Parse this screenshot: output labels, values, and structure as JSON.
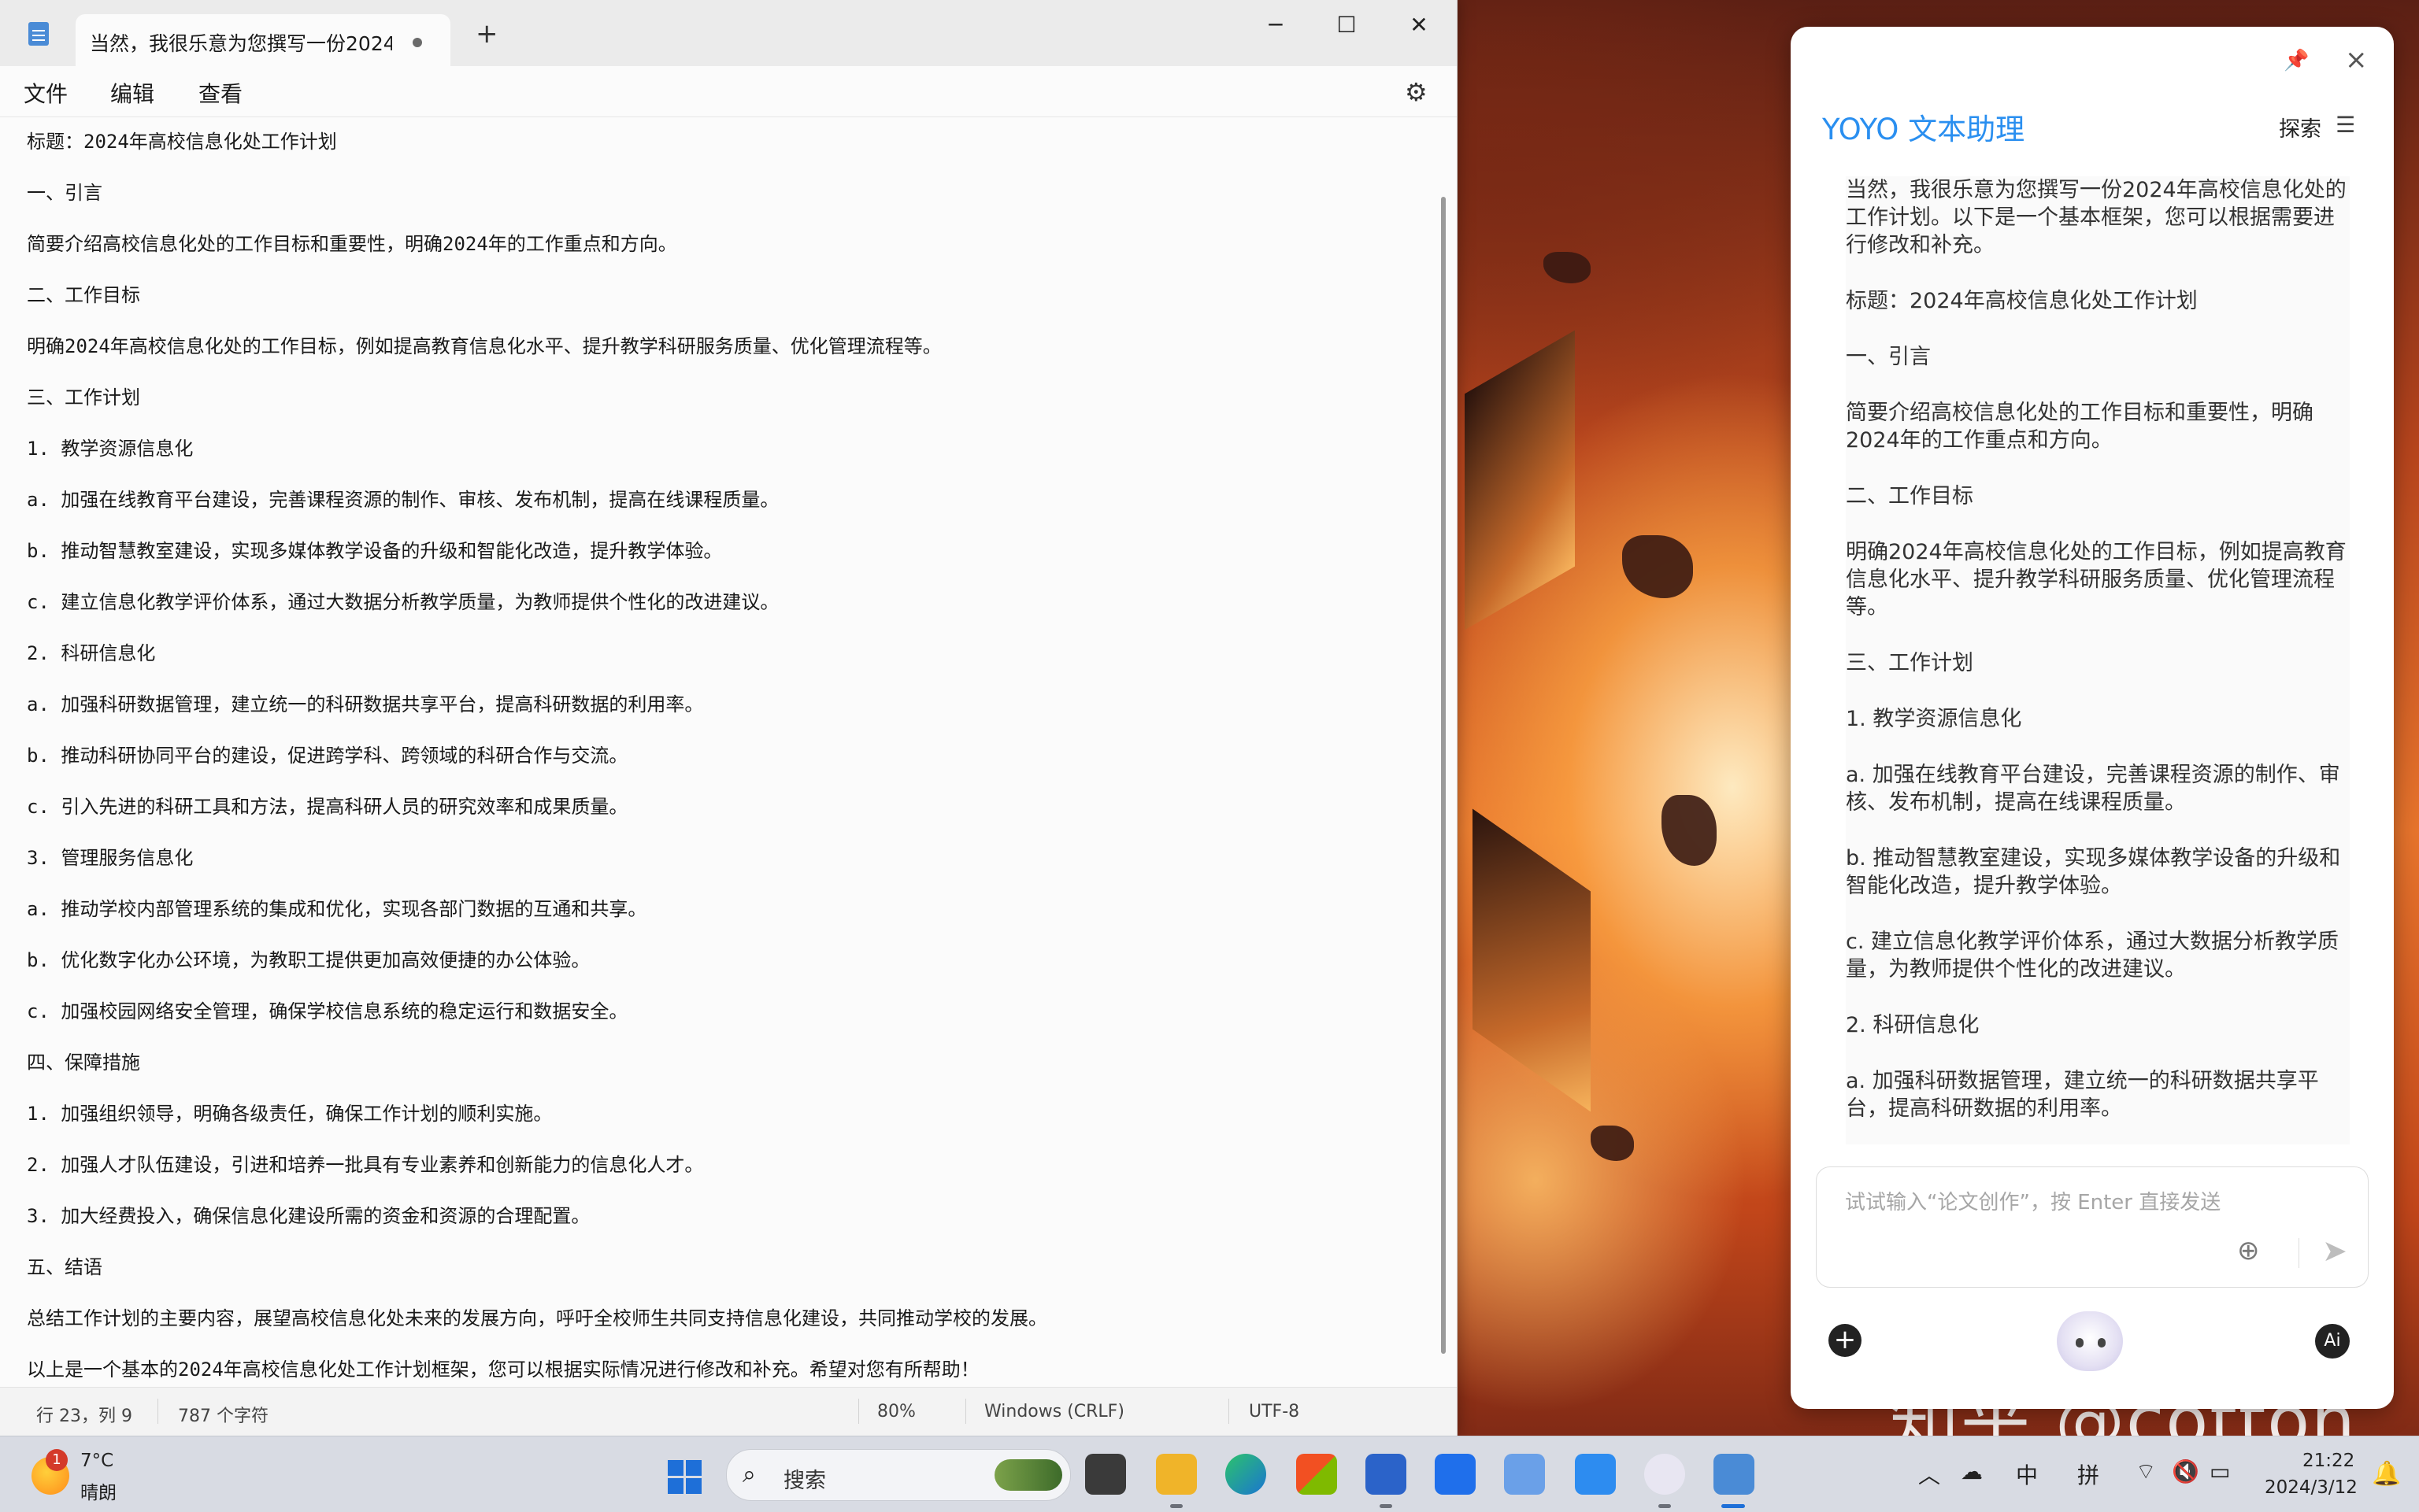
{
  "notepad": {
    "tab_title": "当然，我很乐意为您撰写一份2024年",
    "menu": [
      "文件",
      "编辑",
      "查看"
    ],
    "lines": [
      "标题：2024年高校信息化处工作计划",
      "一、引言",
      "简要介绍高校信息化处的工作目标和重要性，明确2024年的工作重点和方向。",
      "二、工作目标",
      "明确2024年高校信息化处的工作目标，例如提高教育信息化水平、提升教学科研服务质量、优化管理流程等。",
      "三、工作计划",
      "1. 教学资源信息化",
      "a. 加强在线教育平台建设，完善课程资源的制作、审核、发布机制，提高在线课程质量。",
      "b. 推动智慧教室建设，实现多媒体教学设备的升级和智能化改造，提升教学体验。",
      "c. 建立信息化教学评价体系，通过大数据分析教学质量，为教师提供个性化的改进建议。",
      "2. 科研信息化",
      "a. 加强科研数据管理，建立统一的科研数据共享平台，提高科研数据的利用率。",
      "b. 推动科研协同平台的建设，促进跨学科、跨领域的科研合作与交流。",
      "c. 引入先进的科研工具和方法，提高科研人员的研究效率和成果质量。",
      "3. 管理服务信息化",
      "a. 推动学校内部管理系统的集成和优化，实现各部门数据的互通和共享。",
      "b. 优化数字化办公环境，为教职工提供更加高效便捷的办公体验。",
      "c. 加强校园网络安全管理，确保学校信息系统的稳定运行和数据安全。",
      "四、保障措施",
      "1. 加强组织领导，明确各级责任，确保工作计划的顺利实施。",
      "2. 加强人才队伍建设，引进和培养一批具有专业素养和创新能力的信息化人才。",
      "3. 加大经费投入，确保信息化建设所需的资金和资源的合理配置。",
      "五、结语",
      "总结工作计划的主要内容，展望高校信息化处未来的发展方向，呼吁全校师生共同支持信息化建设，共同推动学校的发展。",
      "以上是一个基本的2024年高校信息化处工作计划框架，您可以根据实际情况进行修改和补充。希望对您有所帮助！"
    ],
    "status": {
      "position": "行 23，列 9",
      "chars": "787 个字符",
      "zoom": "80%",
      "line_ending": "Windows (CRLF)",
      "encoding": "UTF-8"
    }
  },
  "yoyo": {
    "title": "YOYO 文本助理",
    "explore": "探索",
    "paragraphs": [
      "当然，我很乐意为您撰写一份2024年高校信息化处的工作计划。以下是一个基本框架，您可以根据需要进行修改和补充。",
      "标题：2024年高校信息化处工作计划",
      "一、引言",
      "简要介绍高校信息化处的工作目标和重要性，明确2024年的工作重点和方向。",
      "二、工作目标",
      "明确2024年高校信息化处的工作目标，例如提高教育信息化水平、提升教学科研服务质量、优化管理流程等。",
      "三、工作计划",
      "1. 教学资源信息化",
      "a. 加强在线教育平台建设，完善课程资源的制作、审核、发布机制，提高在线课程质量。",
      "b. 推动智慧教室建设，实现多媒体教学设备的升级和智能化改造，提升教学体验。",
      "c. 建立信息化教学评价体系，通过大数据分析教学质量，为教师提供个性化的改进建议。",
      "2. 科研信息化",
      "a. 加强科研数据管理，建立统一的科研数据共享平台，提高科研数据的利用率。"
    ],
    "input_placeholder": "试试输入“论文创作”，按 Enter 直接发送",
    "ai_label": "Ai"
  },
  "wallpaper_watermark": "知乎 @cotton",
  "taskbar": {
    "weather_badge": "1",
    "weather_temp": "7°C",
    "weather_desc": "晴朗",
    "search_label": "搜索",
    "ime_mode": "中",
    "ime_name": "拼",
    "time": "21:22",
    "date": "2024/3/12"
  },
  "colors": {
    "accent": "#1e6fd8",
    "yoyo_title": "#2a8ff0"
  }
}
